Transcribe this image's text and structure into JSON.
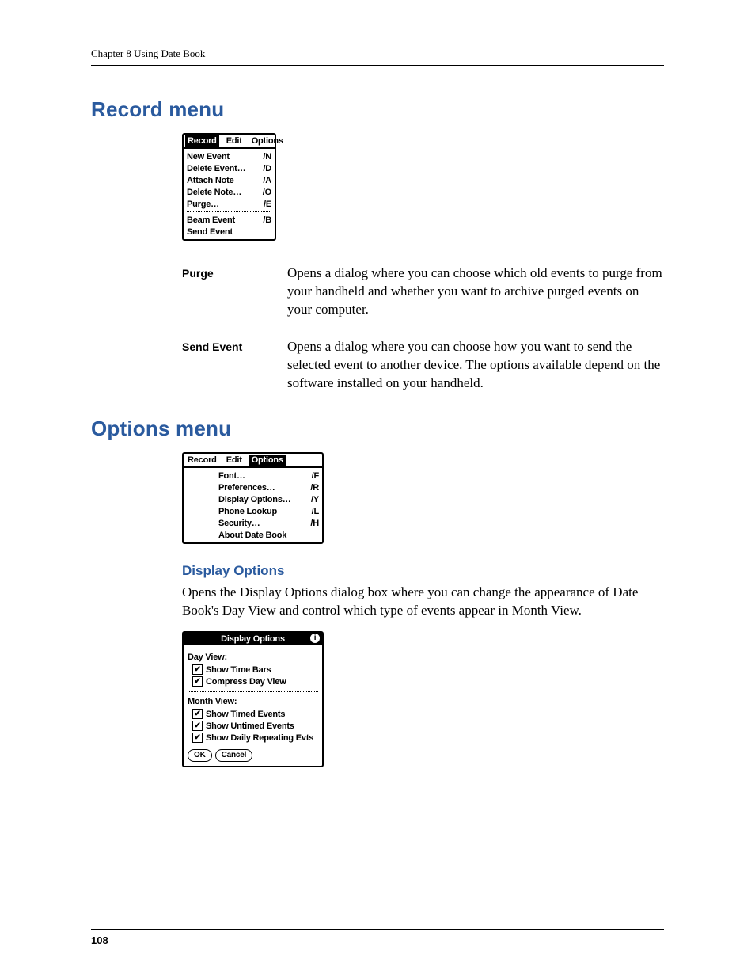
{
  "chapter_line": "Chapter 8   Using Date Book",
  "section_record": "Record menu",
  "record_menu": {
    "bar": [
      "Record",
      "Edit",
      "Options"
    ],
    "selected": 0,
    "groups": [
      [
        {
          "label": "New Event",
          "sc": "/N"
        },
        {
          "label": "Delete Event…",
          "sc": "/D"
        },
        {
          "label": "Attach Note",
          "sc": "/A"
        },
        {
          "label": "Delete Note…",
          "sc": "/O"
        },
        {
          "label": "Purge…",
          "sc": "/E"
        }
      ],
      [
        {
          "label": "Beam Event",
          "sc": "/B"
        },
        {
          "label": "Send Event",
          "sc": ""
        }
      ]
    ]
  },
  "desc": [
    {
      "term": "Purge",
      "def": "Opens a dialog where you can choose which old events to purge from your handheld and whether you want to archive purged events on your computer."
    },
    {
      "term": "Send Event",
      "def": "Opens a dialog where you can choose how you want to send the selected event to another device. The options available depend on the software installed on your handheld."
    }
  ],
  "section_options": "Options menu",
  "options_menu": {
    "bar": [
      "Record",
      "Edit",
      "Options"
    ],
    "selected": 2,
    "items": [
      {
        "label": "Font…",
        "sc": "/F"
      },
      {
        "label": "Preferences…",
        "sc": "/R"
      },
      {
        "label": "Display Options…",
        "sc": "/Y"
      },
      {
        "label": "Phone Lookup",
        "sc": "/L"
      },
      {
        "label": "Security…",
        "sc": "/H"
      },
      {
        "label": "About Date Book",
        "sc": ""
      }
    ]
  },
  "display_options_heading": "Display Options",
  "display_options_text": "Opens the Display Options dialog box where you can change the appearance of Date Book's Day View and control which type of events appear in Month View.",
  "dlg": {
    "title": "Display Options",
    "info_icon": "i",
    "sections": [
      {
        "hdr": "Day View:",
        "items": [
          "Show Time Bars",
          "Compress Day View"
        ]
      },
      {
        "hdr": "Month View:",
        "items": [
          "Show Timed Events",
          "Show Untimed Events",
          "Show Daily Repeating Evts"
        ]
      }
    ],
    "buttons": [
      "OK",
      "Cancel"
    ]
  },
  "page_number": "108"
}
